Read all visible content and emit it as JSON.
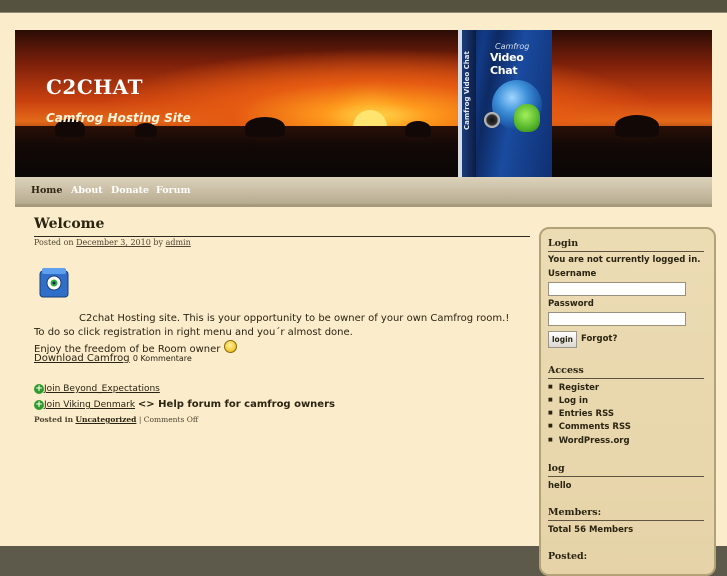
{
  "header": {
    "site_title": "C2CHAT",
    "tagline": "Camfrog Hosting Site",
    "product_box": {
      "brand": "Camfrog",
      "name": "Video Chat",
      "side_text": "Camfrog Video Chat"
    }
  },
  "nav": {
    "items": [
      {
        "label": "Home"
      },
      {
        "label": "About"
      },
      {
        "label": "Donate"
      },
      {
        "label": "Forum"
      }
    ]
  },
  "post": {
    "title": "Welcome",
    "meta_posted_on": "Posted on",
    "meta_date": "December 3, 2010",
    "meta_by": "by",
    "meta_author": "admin",
    "line1": "C2chat Hosting site. This is your opportunity to be owner of your own Camfrog room.!",
    "line2": "To do so click registration in right menu and you´r almost done.",
    "line3": "Enjoy the freedom of be Room owner",
    "download_link": "Download Camfrog",
    "comments_count": "0 Kommentare",
    "join_beyond": "Join Beyond_Expectations",
    "join_viking": "Join Viking Denmark",
    "help_forum": "<> Help forum for camfrog owners",
    "footer_posted_in": "Posted in",
    "footer_category": "Uncategorized",
    "footer_sep": "|",
    "footer_comments": "Comments Off"
  },
  "sidebar": {
    "login": {
      "title": "Login",
      "status": "You are not currently logged in.",
      "username_label": "Username",
      "password_label": "Password",
      "login_button": "login",
      "forgot_link": "Forgot?"
    },
    "access": {
      "title": "Access",
      "items": [
        "Register",
        "Log in",
        "Entries RSS",
        "Comments RSS",
        "WordPress.org"
      ]
    },
    "log": {
      "title": "log",
      "text": "hello"
    },
    "members": {
      "title": "Members:",
      "text": "Total 56 Members"
    },
    "posted": {
      "title": "Posted:"
    }
  }
}
